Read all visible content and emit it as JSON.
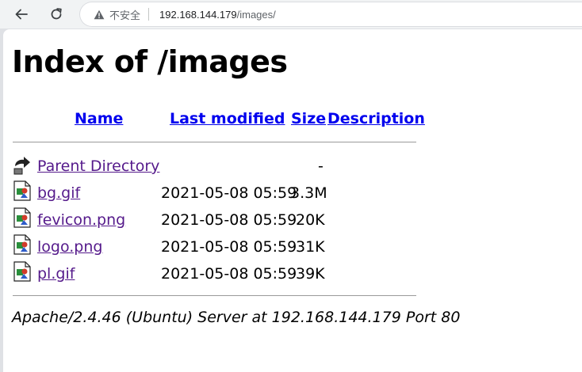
{
  "browser": {
    "security_label": "不安全",
    "url_host": "192.168.144.179",
    "url_path": "/images/"
  },
  "page": {
    "title": "Index of /images",
    "columns": {
      "name": "Name",
      "last_modified": "Last modified",
      "size": "Size",
      "description": "Description"
    },
    "rows": [
      {
        "icon": "back-icon",
        "name": "Parent Directory",
        "modified": "",
        "size": "-"
      },
      {
        "icon": "image-icon",
        "name": "bg.gif",
        "modified": "2021-05-08 05:59",
        "size": "3.3M"
      },
      {
        "icon": "image-icon",
        "name": "fevicon.png",
        "modified": "2021-05-08 05:59",
        "size": "20K"
      },
      {
        "icon": "image-icon",
        "name": "logo.png",
        "modified": "2021-05-08 05:59",
        "size": "31K"
      },
      {
        "icon": "image-icon",
        "name": "pl.gif",
        "modified": "2021-05-08 05:59",
        "size": "39K"
      }
    ],
    "address": "Apache/2.4.46 (Ubuntu) Server at 192.168.144.179 Port 80"
  }
}
